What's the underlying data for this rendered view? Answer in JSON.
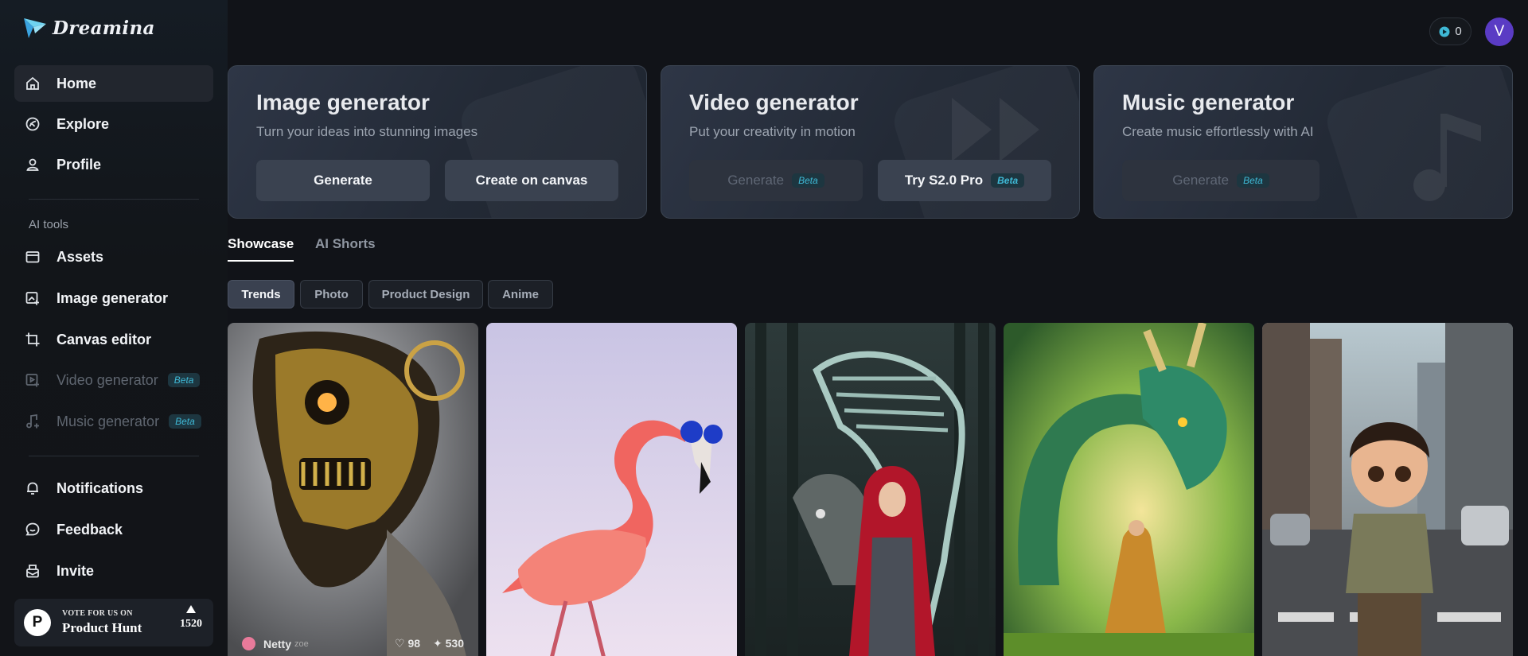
{
  "app": {
    "name": "Dreamina"
  },
  "header": {
    "credits": "0",
    "avatar_initial": "V"
  },
  "sidebar": {
    "items": [
      {
        "label": "Home"
      },
      {
        "label": "Explore"
      },
      {
        "label": "Profile"
      }
    ],
    "section_label": "AI tools",
    "tools": [
      {
        "label": "Assets"
      },
      {
        "label": "Image generator"
      },
      {
        "label": "Canvas editor"
      },
      {
        "label": "Video generator",
        "badge": "Beta"
      },
      {
        "label": "Music generator",
        "badge": "Beta"
      }
    ],
    "bottom": [
      {
        "label": "Notifications"
      },
      {
        "label": "Feedback"
      },
      {
        "label": "Invite"
      }
    ],
    "product_hunt": {
      "small": "VOTE FOR US ON",
      "big": "Product Hunt",
      "logo_letter": "P",
      "count": "1520"
    }
  },
  "generators": [
    {
      "title": "Image generator",
      "subtitle": "Turn your ideas into stunning images",
      "buttons": [
        {
          "label": "Generate"
        },
        {
          "label": "Create on canvas"
        }
      ]
    },
    {
      "title": "Video generator",
      "subtitle": "Put your creativity in motion",
      "buttons": [
        {
          "label": "Generate",
          "badge": "Beta"
        },
        {
          "label": "Try S2.0 Pro",
          "badge": "Beta"
        }
      ]
    },
    {
      "title": "Music generator",
      "subtitle": "Create music effortlessly with AI",
      "buttons": [
        {
          "label": "Generate",
          "badge": "Beta"
        }
      ]
    }
  ],
  "tabs": [
    {
      "label": "Showcase"
    },
    {
      "label": "AI Shorts"
    }
  ],
  "chips": [
    {
      "label": "Trends"
    },
    {
      "label": "Photo"
    },
    {
      "label": "Product Design"
    },
    {
      "label": "Anime"
    }
  ],
  "gallery": [
    {
      "icon": "robot-skull-image",
      "author": "Netty",
      "author_tag": "zoe",
      "likes": "98",
      "uses": "530"
    },
    {
      "icon": "flamingo-image"
    },
    {
      "icon": "red-riding-hood-image"
    },
    {
      "icon": "dragon-image"
    },
    {
      "icon": "boy-street-image"
    }
  ],
  "colors": {
    "accent": "#3fb9d6",
    "avatar": "#5a3bc4",
    "background": "#111318"
  }
}
